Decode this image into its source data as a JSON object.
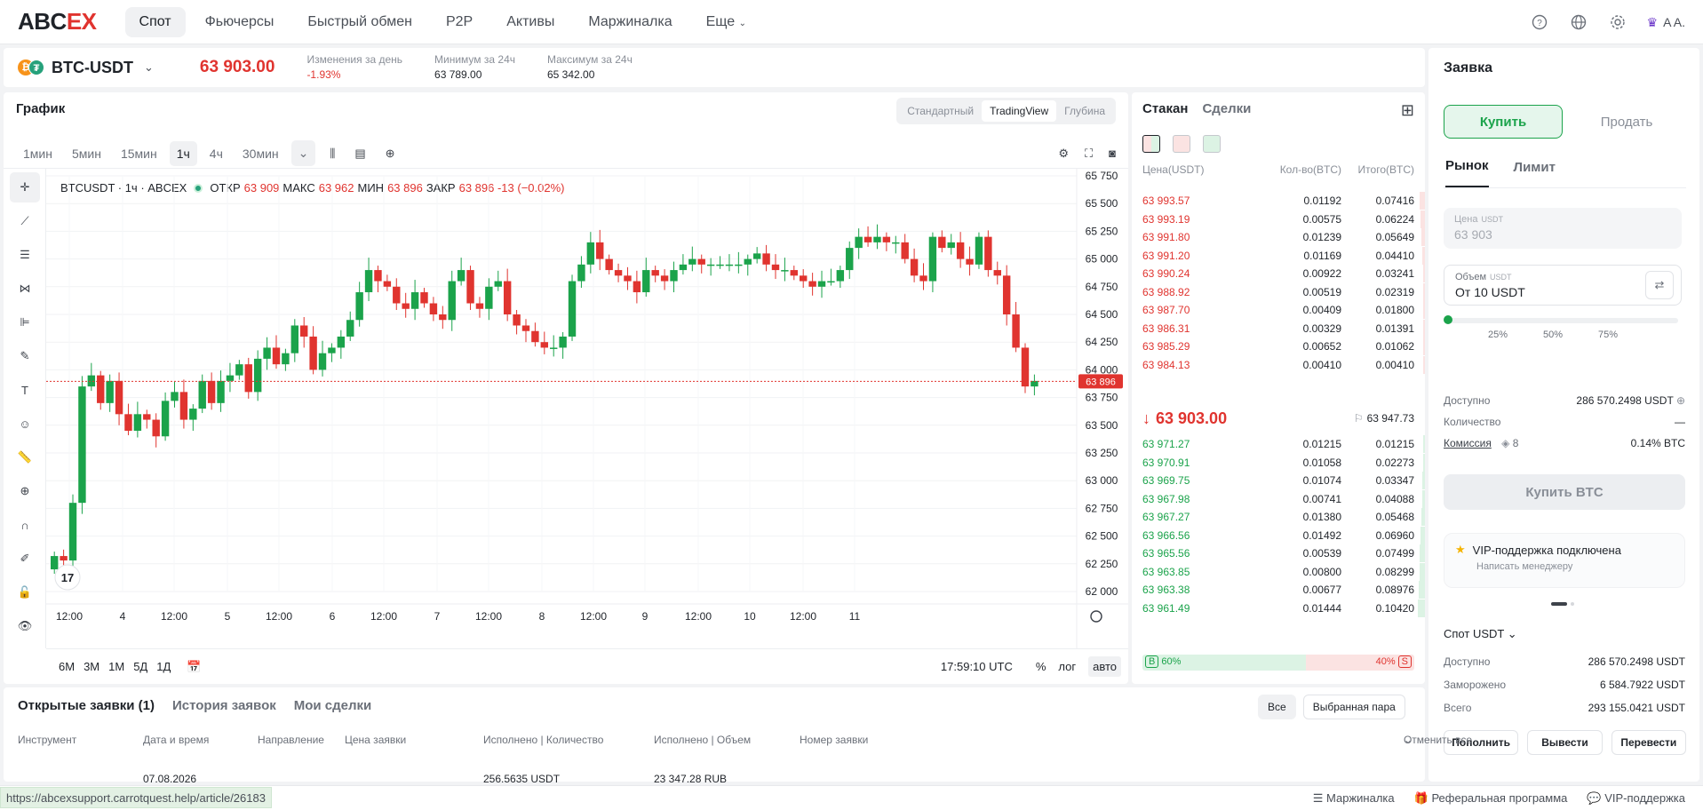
{
  "brand": {
    "logo_text": "ABC",
    "logo_accent": "EX"
  },
  "nav": [
    "Спот",
    "Фьючерсы",
    "Быстрый обмен",
    "P2P",
    "Активы",
    "Маржиналка",
    "Еще"
  ],
  "user": {
    "name": "A A."
  },
  "ticker": {
    "coin1": "₿",
    "coin2": "₮",
    "pair": "BTC-USDT",
    "price": "63 903.00",
    "change_label": "Изменения за день",
    "change_value": "-1.93%",
    "low_label": "Минимум за 24ч",
    "low_value": "63 789.00",
    "high_label": "Максимум за 24ч",
    "high_value": "65 342.00"
  },
  "chart": {
    "title": "График",
    "view_tabs": [
      "Стандартный",
      "TradingView",
      "Глубина"
    ],
    "timeframes": [
      "1мин",
      "5мин",
      "15мин",
      "1ч",
      "4ч",
      "30мин"
    ],
    "legend_symbol": "BTCUSDT · 1ч · ABCEX",
    "o_label": "ОТКР",
    "o_val": "63 909",
    "h_label": "МАКС",
    "h_val": "63 962",
    "l_label": "МИН",
    "l_val": "63 896",
    "c_label": "ЗАКР",
    "c_val": "63 896 -13 (−0.02%)",
    "price_axis": [
      "65 750",
      "65 500",
      "65 250",
      "65 000",
      "64 750",
      "64 500",
      "64 250",
      "64 000",
      "63 750",
      "63 500",
      "63 250",
      "63 000",
      "62 750",
      "62 500",
      "62 250",
      "62 000"
    ],
    "last_price_tag": "63 896",
    "time_axis": [
      "12:00",
      "4",
      "12:00",
      "5",
      "12:00",
      "6",
      "12:00",
      "7",
      "12:00",
      "8",
      "12:00",
      "9",
      "12:00",
      "10",
      "12:00",
      "11"
    ],
    "ranges": [
      "6M",
      "3M",
      "1M",
      "5Д",
      "1Д"
    ],
    "clock": "17:59:10 UTC",
    "pct": "%",
    "log": "лог",
    "auto": "авто",
    "colors": {
      "up": "#1ba34b",
      "down": "#e0342f"
    }
  },
  "orderbook": {
    "tab_book": "Стакан",
    "tab_trades": "Сделки",
    "col_price": "Цена(USDT)",
    "col_qty": "Кол-во(BTC)",
    "col_total": "Итого(BTC)",
    "asks": [
      [
        "63 993.57",
        "0.01192",
        "0.07416"
      ],
      [
        "63 993.19",
        "0.00575",
        "0.06224"
      ],
      [
        "63 991.80",
        "0.01239",
        "0.05649"
      ],
      [
        "63 991.20",
        "0.01169",
        "0.04410"
      ],
      [
        "63 990.24",
        "0.00922",
        "0.03241"
      ],
      [
        "63 988.92",
        "0.00519",
        "0.02319"
      ],
      [
        "63 987.70",
        "0.00409",
        "0.01800"
      ],
      [
        "63 986.31",
        "0.00329",
        "0.01391"
      ],
      [
        "63 985.29",
        "0.00652",
        "0.01062"
      ],
      [
        "63 984.13",
        "0.00410",
        "0.00410"
      ]
    ],
    "mid_price": "63 903.00",
    "mark_price": "63 947.73",
    "bids": [
      [
        "63 971.27",
        "0.01215",
        "0.01215"
      ],
      [
        "63 970.91",
        "0.01058",
        "0.02273"
      ],
      [
        "63 969.75",
        "0.01074",
        "0.03347"
      ],
      [
        "63 967.98",
        "0.00741",
        "0.04088"
      ],
      [
        "63 967.27",
        "0.01380",
        "0.05468"
      ],
      [
        "63 966.56",
        "0.01492",
        "0.06960"
      ],
      [
        "63 965.56",
        "0.00539",
        "0.07499"
      ],
      [
        "63 963.85",
        "0.00800",
        "0.08299"
      ],
      [
        "63 963.38",
        "0.00677",
        "0.08976"
      ],
      [
        "63 961.49",
        "0.01444",
        "0.10420"
      ]
    ],
    "buy_ratio": "60%",
    "sell_ratio": "40%",
    "b": "B",
    "s": "S"
  },
  "order_form": {
    "title": "Заявка",
    "buy": "Купить",
    "sell": "Продать",
    "type_market": "Рынок",
    "type_limit": "Лимит",
    "price_label": "Цена",
    "price_unit": "USDT",
    "price_value": "63 903",
    "amount_label": "Объем",
    "amount_unit": "USDT",
    "amount_placeholder": "От 10 USDT",
    "slider_marks": [
      "25%",
      "50%",
      "75%"
    ],
    "available_label": "Доступно",
    "available_value": "286 570.2498 USDT",
    "qty_label": "Количество",
    "qty_value": "—",
    "fee_label": "Комиссия",
    "fee_level": "8",
    "fee_value": "0.14% BTC",
    "submit": "Купить BTC",
    "vip_title": "VIP-поддержка подключена",
    "vip_sub": "Написать менеджеру",
    "account_select": "Спот USDT",
    "bal_available_label": "Доступно",
    "bal_available": "286 570.2498 USDT",
    "bal_frozen_label": "Заморожено",
    "bal_frozen": "6 584.7922 USDT",
    "bal_total_label": "Всего",
    "bal_total": "293 155.0421 USDT",
    "deposit": "Пополнить",
    "withdraw": "Вывести",
    "transfer": "Перевести"
  },
  "orders": {
    "tabs": [
      "Открытые заявки (1)",
      "История заявок",
      "Мои сделки"
    ],
    "filter_all": "Все",
    "filter_pair": "Выбранная пара",
    "columns": [
      "Инструмент",
      "Дата и время",
      "Направление",
      "Цена заявки",
      "Исполнено | Количество",
      "Исполнено | Объем",
      "Номер заявки",
      "Отменить все"
    ],
    "row_date": "07.08.2026",
    "row_qty": "256.5635 USDT",
    "row_vol": "23 347.28 RUB"
  },
  "footer": {
    "margin": "Маржиналка",
    "referral": "Реферальная программа",
    "vip": "VIP-поддержка"
  },
  "status_url": "https://abcexsupport.carrotquest.help/article/26183"
}
